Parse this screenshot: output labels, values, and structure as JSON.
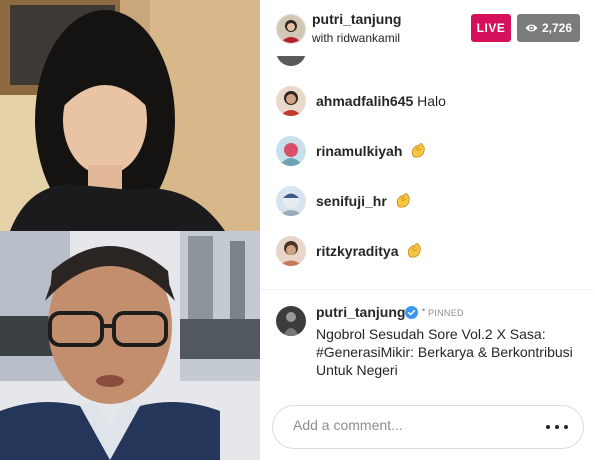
{
  "header": {
    "host_username": "putri_tanjung",
    "host_subtitle": "with ridwankamil",
    "live_label": "LIVE",
    "viewer_count": "2,726"
  },
  "comments": [
    {
      "user": "ahmadfalih645",
      "text": "Halo",
      "emoji": false
    },
    {
      "user": "rinamulkiyah",
      "text": "",
      "emoji": true
    },
    {
      "user": "senifuji_hr",
      "text": "",
      "emoji": true
    },
    {
      "user": "ritzkyraditya",
      "text": "",
      "emoji": true
    }
  ],
  "pinned": {
    "user": "putri_tanjung",
    "dot": "•",
    "label": "PINNED",
    "message": "Ngobrol Sesudah Sore Vol.2 X Sasa: #GenerasiMikir: Berkarya & Berkontribusi Untuk Negeri"
  },
  "comment_input": {
    "placeholder": "Add a comment..."
  },
  "icons": {
    "viewers": "eye-icon",
    "verified": "verified-badge-icon",
    "wave": "clapping-hands-emoji",
    "more": "more-horizontal-icon"
  },
  "colors": {
    "live": "#d6105b",
    "viewers_bg": "#7b7b7b",
    "verified": "#3897f0"
  }
}
